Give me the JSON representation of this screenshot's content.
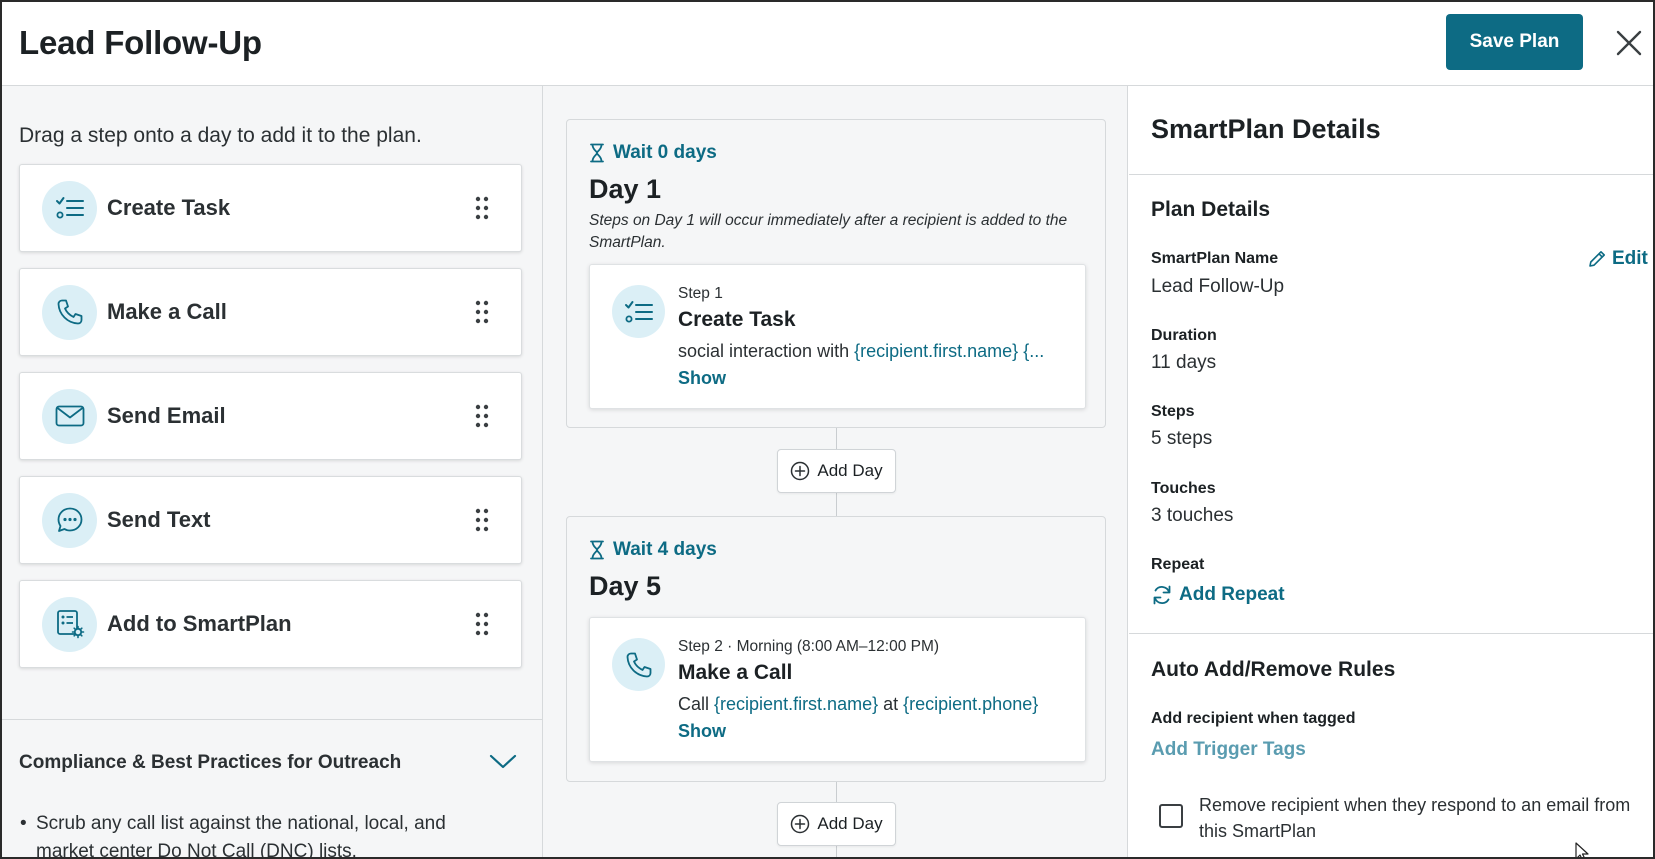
{
  "header": {
    "title": "Lead Follow-Up",
    "save_label": "Save Plan"
  },
  "steps_panel": {
    "hint": "Drag a step onto a day to add it to the plan.",
    "items": [
      {
        "label": "Create Task",
        "icon": "task-list-icon"
      },
      {
        "label": "Make a Call",
        "icon": "phone-icon"
      },
      {
        "label": "Send Email",
        "icon": "envelope-icon"
      },
      {
        "label": "Send Text",
        "icon": "chat-bubble-icon"
      },
      {
        "label": "Add to SmartPlan",
        "icon": "smartplan-gear-icon"
      }
    ],
    "compliance": {
      "title": "Compliance & Best Practices for Outreach",
      "bullet": "Scrub any call list against the national, local, and market center Do Not Call (DNC) lists."
    }
  },
  "timeline": {
    "add_day_label": "Add Day",
    "days": [
      {
        "wait": "Wait 0 days",
        "title": "Day 1",
        "note": "Steps on Day 1 will occur immediately after a recipient is added to the SmartPlan.",
        "step": {
          "meta": "Step 1",
          "title": "Create Task",
          "body_text": "social interaction with ",
          "body_var1": "{recipient.first.name}",
          "body_var2": " {...",
          "show": "Show"
        }
      },
      {
        "wait": "Wait 4 days",
        "title": "Day 5",
        "step": {
          "meta": "Step 2 · Morning (8:00 AM–12:00 PM)",
          "title": "Make a Call",
          "body_text": "Call ",
          "body_var1": "{recipient.first.name}",
          "body_mid": " at ",
          "body_var2": "{recipient.phone}",
          "show": "Show"
        }
      }
    ]
  },
  "details": {
    "title": "SmartPlan Details",
    "plan_section": "Plan Details",
    "edit_label": "Edit",
    "name_label": "SmartPlan Name",
    "name_value": "Lead Follow-Up",
    "duration_label": "Duration",
    "duration_value": "11 days",
    "steps_label": "Steps",
    "steps_value": "5 steps",
    "touches_label": "Touches",
    "touches_value": "3 touches",
    "repeat_label": "Repeat",
    "add_repeat": "Add Repeat",
    "rules_section": "Auto Add/Remove Rules",
    "tagged_label": "Add recipient when tagged",
    "trigger_link": "Add Trigger Tags",
    "remove_checkbox_label": "Remove recipient when they respond to an email from this SmartPlan",
    "remove_checked": false
  },
  "colors": {
    "accent": "#0d6b84",
    "icon_bg": "#dbeff6",
    "panel_bg": "#f5f6f7"
  }
}
